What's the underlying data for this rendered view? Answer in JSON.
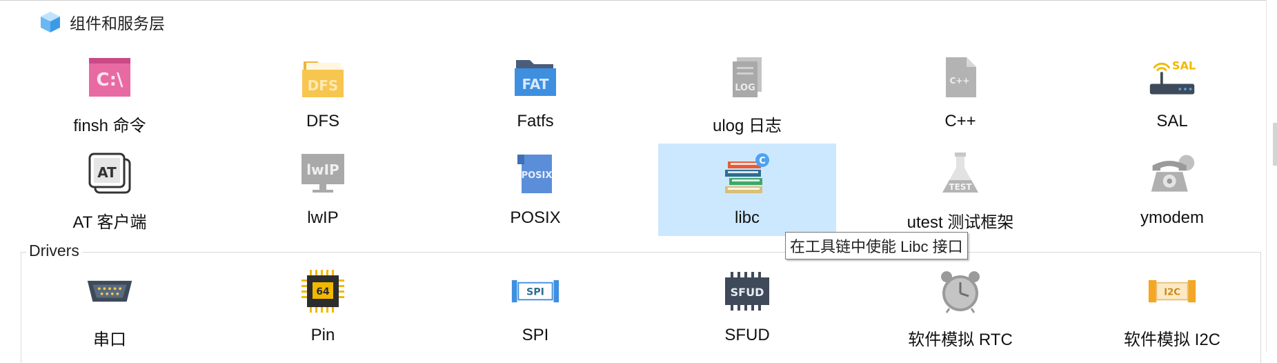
{
  "section": {
    "title": "组件和服务层"
  },
  "components_row1": [
    {
      "label": "finsh 命令",
      "icon": "terminal-icon"
    },
    {
      "label": "DFS",
      "icon": "folder-dfs-icon"
    },
    {
      "label": "Fatfs",
      "icon": "folder-fat-icon"
    },
    {
      "label": "ulog 日志",
      "icon": "log-file-icon"
    },
    {
      "label": "C++",
      "icon": "cpp-file-icon"
    },
    {
      "label": "SAL",
      "icon": "router-sal-icon"
    }
  ],
  "components_row2": [
    {
      "label": "AT 客户端",
      "icon": "at-icon"
    },
    {
      "label": "lwIP",
      "icon": "monitor-lwip-icon"
    },
    {
      "label": "POSIX",
      "icon": "posix-file-icon"
    },
    {
      "label": "libc",
      "icon": "books-icon",
      "selected": true
    },
    {
      "label": "utest 测试框架",
      "icon": "flask-test-icon"
    },
    {
      "label": "ymodem",
      "icon": "telephone-icon"
    }
  ],
  "tooltip": {
    "text": "在工具链中使能 Libc 接口"
  },
  "drivers": {
    "legend": "Drivers",
    "items": [
      {
        "label": "串口",
        "icon": "serial-port-icon"
      },
      {
        "label": "Pin",
        "icon": "chip-64-icon"
      },
      {
        "label": "SPI",
        "icon": "spi-icon"
      },
      {
        "label": "SFUD",
        "icon": "sfud-chip-icon"
      },
      {
        "label": "软件模拟 RTC",
        "icon": "clock-icon"
      },
      {
        "label": "软件模拟 I2C",
        "icon": "i2c-icon"
      }
    ]
  },
  "colors": {
    "selection": "#cce8ff",
    "finsh": "#e86aa3",
    "folder": "#f7c64f",
    "fat_blue": "#3f8fe0",
    "gray_icon": "#a9a9a9"
  }
}
